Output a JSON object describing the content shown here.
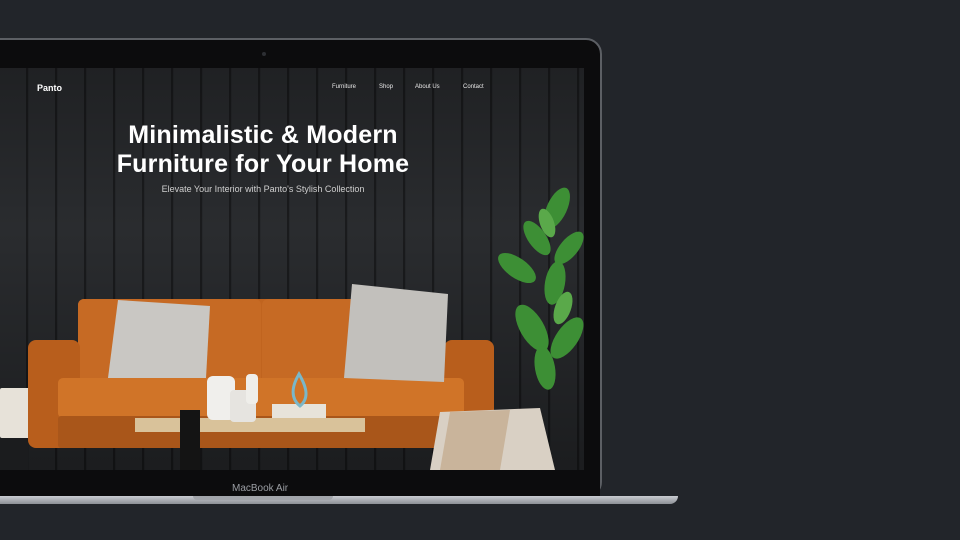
{
  "site": {
    "brand": "Panto",
    "nav": [
      "Furniture",
      "Shop",
      "About Us",
      "Contact"
    ],
    "hero_line1": "Minimalistic & Modern",
    "hero_line2": "Furniture for Your Home",
    "hero_subtitle": "Elevate Your Interior with Panto's Stylish Collection"
  },
  "device": {
    "model": "MacBook Air"
  },
  "colors": {
    "background": "#22252a",
    "sofa": "#c66a24",
    "wall": "#2a2c2f"
  }
}
